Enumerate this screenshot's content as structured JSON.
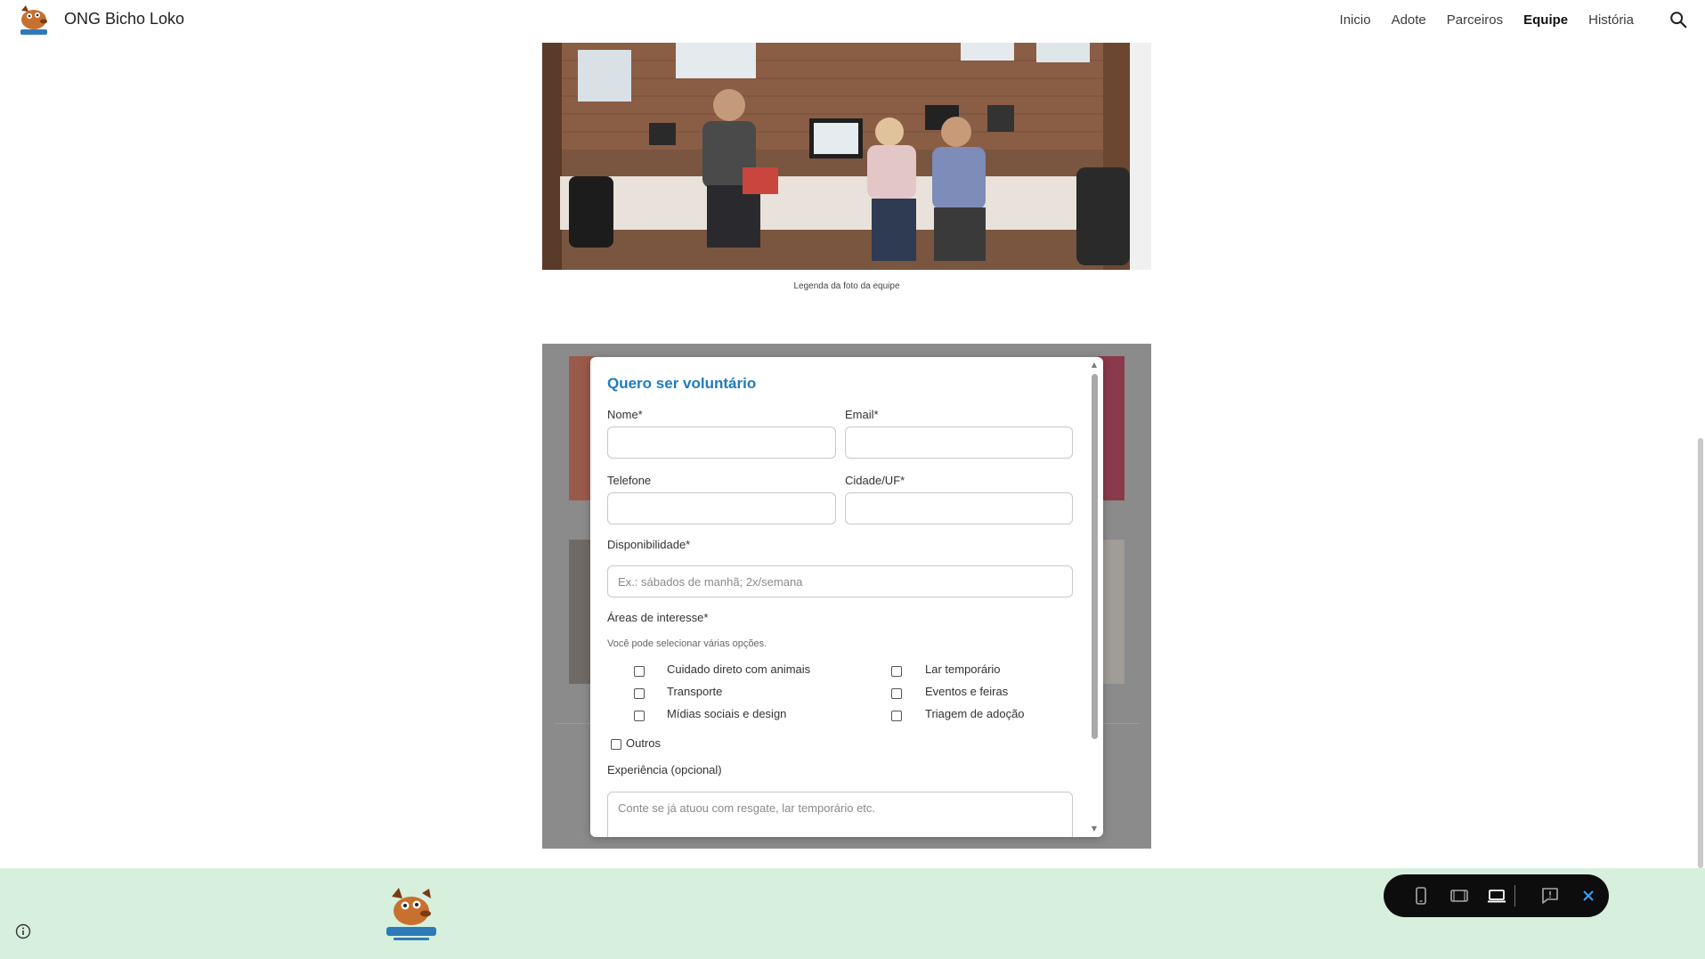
{
  "header": {
    "site_title": "ONG Bicho Loko",
    "nav": [
      "Inicio",
      "Adote",
      "Parceiros",
      "Equipe",
      "História"
    ],
    "active_nav": "Equipe",
    "search_icon": "search-icon"
  },
  "team": {
    "caption": "Legenda da foto da equipe"
  },
  "form": {
    "title": "Quero ser voluntário",
    "name_label": "Nome*",
    "email_label": "Email*",
    "phone_label": "Telefone",
    "city_label": "Cidade/UF*",
    "availability_label": "Disponibilidade*",
    "availability_placeholder": "Ex.: sábados de manhã; 2x/semana",
    "interests_label": "Áreas de interesse*",
    "interests_hint": "Você pode selecionar várias opções.",
    "interests_left": [
      "Cuidado direto com animais",
      "Transporte",
      "Mídias sociais e design"
    ],
    "interests_right": [
      "Lar temporário",
      "Eventos e feiras",
      "Triagem de adoção"
    ],
    "other_label": "Outros",
    "experience_label": "Experiência (opcional)",
    "experience_placeholder": "Conte se já atuou com resgate, lar temporário etc."
  },
  "toolbar": {
    "icons": [
      "phone-view-icon",
      "tablet-view-icon",
      "laptop-view-icon",
      "report-icon",
      "close-icon"
    ]
  },
  "colors": {
    "accent": "#1f7bc0",
    "footer_bg": "#d6f0dd",
    "toolbar_bg": "#0d0d0d"
  }
}
